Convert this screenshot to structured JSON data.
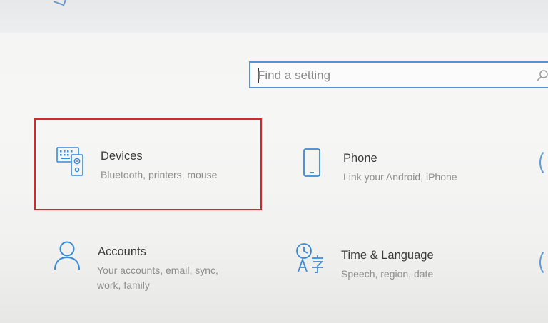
{
  "search": {
    "placeholder": "Find a setting",
    "icon": "search-icon"
  },
  "highlight_color": "#d6262b",
  "accent_color": "#3a8ad6",
  "tiles": [
    {
      "title": "Devices",
      "description": "Bluetooth, printers, mouse",
      "icon": "devices-icon",
      "highlighted": true
    },
    {
      "title": "Phone",
      "description": "Link your Android, iPhone",
      "icon": "phone-icon",
      "highlighted": false
    },
    {
      "title": "Accounts",
      "description_line1": "Your accounts, email, sync,",
      "description_line2": "work, family",
      "icon": "person-icon",
      "highlighted": false
    },
    {
      "title": "Time & Language",
      "description": "Speech, region, date",
      "icon": "time-language-icon",
      "highlighted": false
    }
  ]
}
